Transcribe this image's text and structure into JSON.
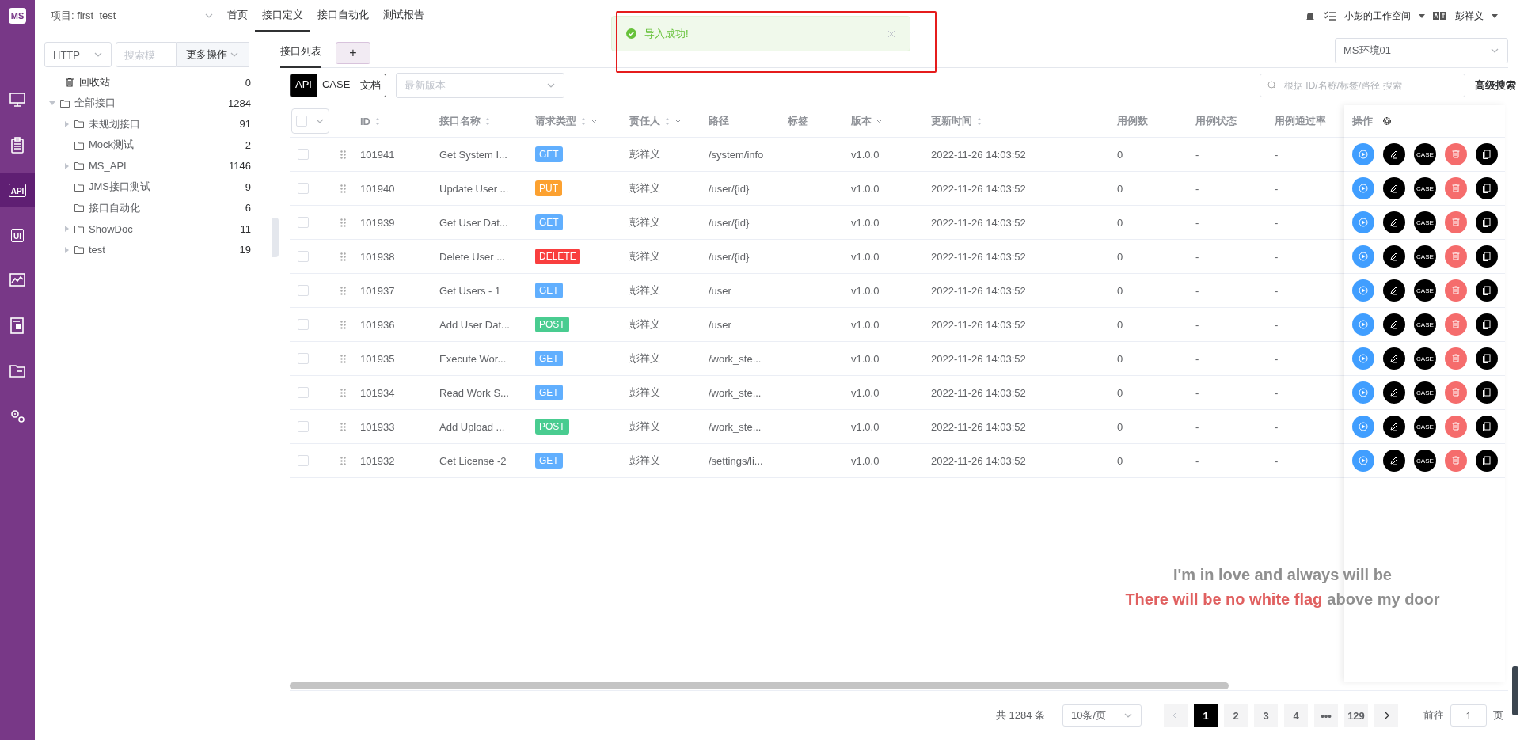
{
  "logo": {
    "text": "MS"
  },
  "nav_rail": [
    {
      "kind": "monitor",
      "selected": false
    },
    {
      "kind": "clipboard",
      "selected": false
    },
    {
      "kind": "api",
      "label": "API",
      "selected": true
    },
    {
      "kind": "ui",
      "label": "UI",
      "selected": false
    },
    {
      "kind": "chart",
      "selected": false
    },
    {
      "kind": "doc",
      "selected": false
    },
    {
      "kind": "folder",
      "selected": false
    },
    {
      "kind": "gears",
      "selected": false
    }
  ],
  "top_bar": {
    "project": "项目: first_test",
    "tabs": [
      {
        "label": "首页",
        "selected": false
      },
      {
        "label": "接口定义",
        "selected": true
      },
      {
        "label": "接口自动化",
        "selected": false
      },
      {
        "label": "测试报告",
        "selected": false
      }
    ],
    "workspace": "小彭的工作空间",
    "user": "彭祥义"
  },
  "toast": {
    "message": "导入成功!",
    "highlighted": true
  },
  "tree_panel": {
    "protocol": "HTTP",
    "search_placeholder": "搜索模",
    "more_button": "更多操作",
    "recycle": {
      "label": "回收站",
      "count": "0"
    },
    "tree": [
      {
        "kind": "branch",
        "label": "全部接口",
        "count": "1284",
        "expanded": true,
        "children": [
          {
            "kind": "branch",
            "label": "未规划接口",
            "count": "91",
            "expanded": false
          },
          {
            "kind": "leaf",
            "label": "Mock测试",
            "count": "2"
          },
          {
            "kind": "branch",
            "label": "MS_API",
            "count": "1146",
            "expanded": false
          },
          {
            "kind": "leaf",
            "label": "JMS接口测试",
            "count": "9"
          },
          {
            "kind": "leaf",
            "label": "接口自动化",
            "count": "6"
          },
          {
            "kind": "branch",
            "label": "ShowDoc",
            "count": "11",
            "expanded": false
          },
          {
            "kind": "branch",
            "label": "test",
            "count": "19",
            "expanded": false
          }
        ]
      }
    ]
  },
  "main": {
    "tabs": [
      {
        "label": "接口列表",
        "selected": true
      }
    ],
    "add_tab": "+",
    "environment": "MS环境01",
    "modes": [
      {
        "label": "API",
        "selected": true
      },
      {
        "label": "CASE",
        "selected": false
      },
      {
        "label": "文档",
        "selected": false
      }
    ],
    "version_placeholder": "最新版本",
    "search_placeholder": "根据 ID/名称/标签/路径 搜索",
    "advanced_search": "高级搜索",
    "table": {
      "columns": [
        {
          "label": "ID",
          "sortable": true,
          "filter": false
        },
        {
          "label": "接口名称",
          "sortable": true,
          "filter": false
        },
        {
          "label": "请求类型",
          "sortable": true,
          "filter": true
        },
        {
          "label": "责任人",
          "sortable": true,
          "filter": true
        },
        {
          "label": "路径",
          "sortable": false,
          "filter": false
        },
        {
          "label": "标签",
          "sortable": false,
          "filter": false
        },
        {
          "label": "版本",
          "sortable": false,
          "filter": true
        },
        {
          "label": "更新时间",
          "sortable": true,
          "filter": false
        },
        {
          "label": "用例数",
          "sortable": false,
          "filter": false
        },
        {
          "label": "用例状态",
          "sortable": false,
          "filter": false
        },
        {
          "label": "用例通过率",
          "sortable": false,
          "filter": false
        }
      ],
      "actions_header": "操作",
      "rows": [
        {
          "selected": false,
          "id": "101941",
          "name": "Get System I...",
          "method": "GET",
          "color": "#61affe",
          "owner": "彭祥义",
          "path": "/system/info",
          "version": "v1.0.0",
          "updated": "2022-11-26 14:03:52",
          "cases": "0",
          "case_status": "-",
          "pass_rate": "-",
          "case_button": "CASE"
        },
        {
          "selected": false,
          "id": "101940",
          "name": "Update User ...",
          "method": "PUT",
          "color": "#fca130",
          "owner": "彭祥义",
          "path": "/user/{id}",
          "version": "v1.0.0",
          "updated": "2022-11-26 14:03:52",
          "cases": "0",
          "case_status": "-",
          "pass_rate": "-",
          "case_button": "CASE"
        },
        {
          "selected": false,
          "id": "101939",
          "name": "Get User Dat...",
          "method": "GET",
          "color": "#61affe",
          "owner": "彭祥义",
          "path": "/user/{id}",
          "version": "v1.0.0",
          "updated": "2022-11-26 14:03:52",
          "cases": "0",
          "case_status": "-",
          "pass_rate": "-",
          "case_button": "CASE"
        },
        {
          "selected": false,
          "id": "101938",
          "name": "Delete User ...",
          "method": "DELETE",
          "color": "#f93e3e",
          "owner": "彭祥义",
          "path": "/user/{id}",
          "version": "v1.0.0",
          "updated": "2022-11-26 14:03:52",
          "cases": "0",
          "case_status": "-",
          "pass_rate": "-",
          "case_button": "CASE"
        },
        {
          "selected": false,
          "id": "101937",
          "name": "Get Users - 1",
          "method": "GET",
          "color": "#61affe",
          "owner": "彭祥义",
          "path": "/user",
          "version": "v1.0.0",
          "updated": "2022-11-26 14:03:52",
          "cases": "0",
          "case_status": "-",
          "pass_rate": "-",
          "case_button": "CASE"
        },
        {
          "selected": false,
          "id": "101936",
          "name": "Add User Dat...",
          "method": "POST",
          "color": "#49cc90",
          "owner": "彭祥义",
          "path": "/user",
          "version": "v1.0.0",
          "updated": "2022-11-26 14:03:52",
          "cases": "0",
          "case_status": "-",
          "pass_rate": "-",
          "case_button": "CASE"
        },
        {
          "selected": false,
          "id": "101935",
          "name": "Execute Wor...",
          "method": "GET",
          "color": "#61affe",
          "owner": "彭祥义",
          "path": "/work_ste...",
          "version": "v1.0.0",
          "updated": "2022-11-26 14:03:52",
          "cases": "0",
          "case_status": "-",
          "pass_rate": "-",
          "case_button": "CASE"
        },
        {
          "selected": false,
          "id": "101934",
          "name": "Read Work S...",
          "method": "GET",
          "color": "#61affe",
          "owner": "彭祥义",
          "path": "/work_ste...",
          "version": "v1.0.0",
          "updated": "2022-11-26 14:03:52",
          "cases": "0",
          "case_status": "-",
          "pass_rate": "-",
          "case_button": "CASE"
        },
        {
          "selected": false,
          "id": "101933",
          "name": "Add Upload ...",
          "method": "POST",
          "color": "#49cc90",
          "owner": "彭祥义",
          "path": "/work_ste...",
          "version": "v1.0.0",
          "updated": "2022-11-26 14:03:52",
          "cases": "0",
          "case_status": "-",
          "pass_rate": "-",
          "case_button": "CASE"
        },
        {
          "selected": false,
          "id": "101932",
          "name": "Get License -2",
          "method": "GET",
          "color": "#61affe",
          "owner": "彭祥义",
          "path": "/settings/li...",
          "version": "v1.0.0",
          "updated": "2022-11-26 14:03:52",
          "cases": "0",
          "case_status": "-",
          "pass_rate": "-",
          "case_button": "CASE"
        }
      ]
    },
    "pagination": {
      "total": "共 1284 条",
      "page_size": "10条/页",
      "pages": [
        {
          "label": "1",
          "selected": true
        },
        {
          "label": "2",
          "selected": false
        },
        {
          "label": "3",
          "selected": false
        },
        {
          "label": "4",
          "selected": false
        },
        {
          "label": "•••",
          "selected": false
        },
        {
          "label": "129",
          "selected": false
        }
      ],
      "goto_label": "前往",
      "goto_value": "1",
      "goto_suffix": "页"
    }
  },
  "lyrics": {
    "lines": [
      [
        {
          "text": "I'm in love and always will be",
          "sung": false
        }
      ],
      [
        {
          "text": "There will be no white flag",
          "sung": true
        },
        {
          "text": "above my door",
          "sung": false
        }
      ]
    ]
  }
}
